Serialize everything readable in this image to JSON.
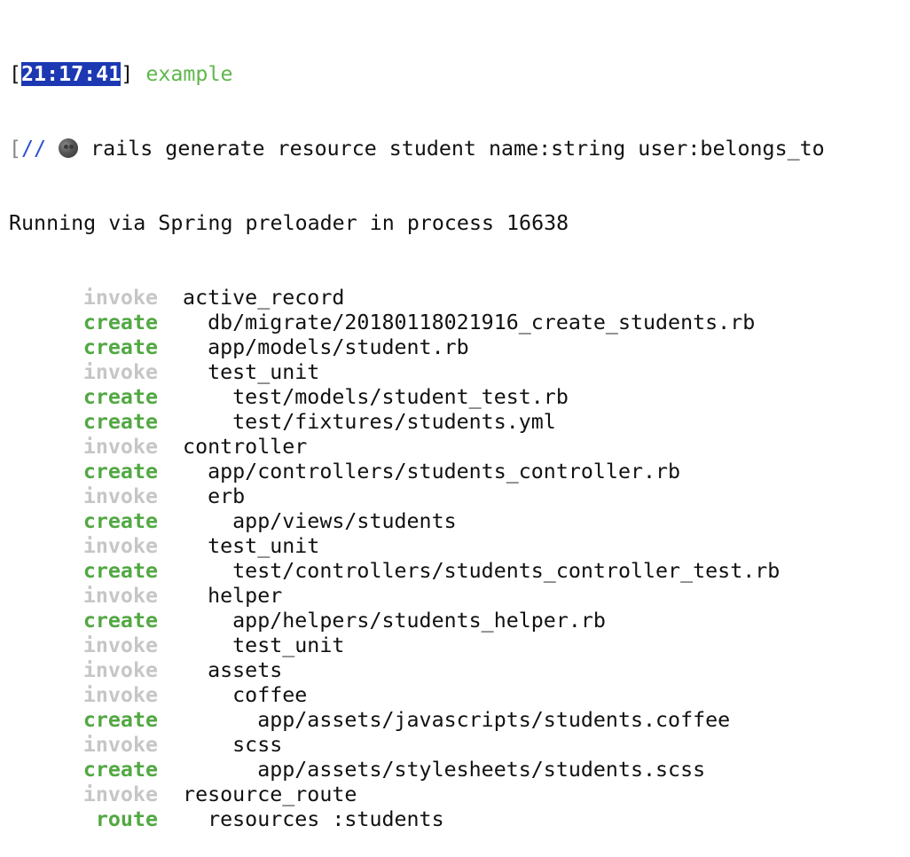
{
  "prompt": {
    "open_bracket": "[",
    "timestamp": "21:17:41",
    "close_bracket": "]",
    "branch": "example"
  },
  "command_line": {
    "prefix_bracket": "[",
    "slashes": "//",
    "icon": "moon-emoji-icon",
    "command": "rails generate resource student name:string user:belongs_to"
  },
  "spring_message": "Running via Spring preloader in process 16638",
  "output": [
    {
      "action": "invoke",
      "indent": 0,
      "text": "active_record"
    },
    {
      "action": "create",
      "indent": 1,
      "text": "db/migrate/20180118021916_create_students.rb"
    },
    {
      "action": "create",
      "indent": 1,
      "text": "app/models/student.rb"
    },
    {
      "action": "invoke",
      "indent": 1,
      "text": "test_unit"
    },
    {
      "action": "create",
      "indent": 2,
      "text": "test/models/student_test.rb"
    },
    {
      "action": "create",
      "indent": 2,
      "text": "test/fixtures/students.yml"
    },
    {
      "action": "invoke",
      "indent": 0,
      "text": "controller"
    },
    {
      "action": "create",
      "indent": 1,
      "text": "app/controllers/students_controller.rb"
    },
    {
      "action": "invoke",
      "indent": 1,
      "text": "erb"
    },
    {
      "action": "create",
      "indent": 2,
      "text": "app/views/students"
    },
    {
      "action": "invoke",
      "indent": 1,
      "text": "test_unit"
    },
    {
      "action": "create",
      "indent": 2,
      "text": "test/controllers/students_controller_test.rb"
    },
    {
      "action": "invoke",
      "indent": 1,
      "text": "helper"
    },
    {
      "action": "create",
      "indent": 2,
      "text": "app/helpers/students_helper.rb"
    },
    {
      "action": "invoke",
      "indent": 2,
      "text": "test_unit"
    },
    {
      "action": "invoke",
      "indent": 1,
      "text": "assets"
    },
    {
      "action": "invoke",
      "indent": 2,
      "text": "coffee"
    },
    {
      "action": "create",
      "indent": 3,
      "text": "app/assets/javascripts/students.coffee"
    },
    {
      "action": "invoke",
      "indent": 2,
      "text": "scss"
    },
    {
      "action": "create",
      "indent": 3,
      "text": "app/assets/stylesheets/students.scss"
    },
    {
      "action": "invoke",
      "indent": 0,
      "text": "resource_route"
    },
    {
      "action": "route",
      "indent": 1,
      "text": "resources :students"
    }
  ],
  "colors": {
    "timestamp_bg": "#1c39b3",
    "branch": "#5fb74a",
    "invoke": "#c6c6c6",
    "create": "#52a843",
    "text": "#111111"
  }
}
